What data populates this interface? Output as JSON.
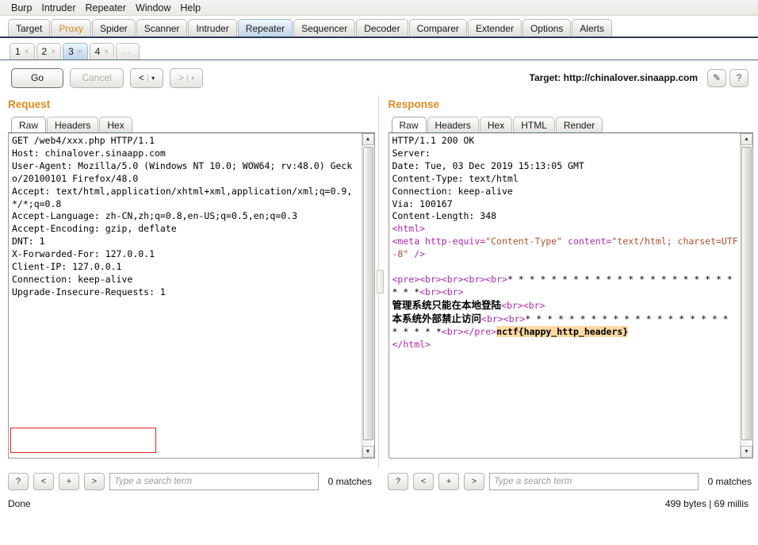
{
  "menu": {
    "items": [
      "Burp",
      "Intruder",
      "Repeater",
      "Window",
      "Help"
    ]
  },
  "main_tabs": [
    {
      "label": "Target",
      "selected": false
    },
    {
      "label": "Proxy",
      "selected": false
    },
    {
      "label": "Spider",
      "selected": false
    },
    {
      "label": "Scanner",
      "selected": false
    },
    {
      "label": "Intruder",
      "selected": false
    },
    {
      "label": "Repeater",
      "selected": true
    },
    {
      "label": "Sequencer",
      "selected": false
    },
    {
      "label": "Decoder",
      "selected": false
    },
    {
      "label": "Comparer",
      "selected": false
    },
    {
      "label": "Extender",
      "selected": false
    },
    {
      "label": "Options",
      "selected": false
    },
    {
      "label": "Alerts",
      "selected": false
    }
  ],
  "repeater_tabs": [
    {
      "label": "1",
      "close": "×",
      "selected": false
    },
    {
      "label": "2",
      "close": "×",
      "selected": false
    },
    {
      "label": "3",
      "close": "×",
      "selected": true
    },
    {
      "label": "4",
      "close": "×",
      "selected": false
    },
    {
      "label": "...",
      "close": "",
      "selected": false
    }
  ],
  "toolbar": {
    "go_label": "Go",
    "cancel_label": "Cancel",
    "back_label": "<",
    "forward_label": ">",
    "caret": "▾",
    "separator": "|",
    "target_label": "Target: http://chinalover.sinaapp.com",
    "edit_icon": "✎",
    "help_icon": "?"
  },
  "request": {
    "title": "Request",
    "tabs": [
      {
        "label": "Raw",
        "selected": true
      },
      {
        "label": "Headers",
        "selected": false
      },
      {
        "label": "Hex",
        "selected": false
      }
    ],
    "body": "GET /web4/xxx.php HTTP/1.1\nHost: chinalover.sinaapp.com\nUser-Agent: Mozilla/5.0 (Windows NT 10.0; WOW64; rv:48.0) Gecko/20100101 Firefox/48.0\nAccept: text/html,application/xhtml+xml,application/xml;q=0.9,*/*;q=0.8\nAccept-Language: zh-CN,zh;q=0.8,en-US;q=0.5,en;q=0.3\nAccept-Encoding: gzip, deflate\nDNT: 1\nX-Forwarded-For: 127.0.0.1\nClient-IP: 127.0.0.1\nConnection: keep-alive\nUpgrade-Insecure-Requests: 1\n",
    "highlighted_headers": [
      "X-Forwarded-For: 127.0.0.1",
      "Client-IP: 127.0.0.1"
    ],
    "highlight_color": "#e02020",
    "search": {
      "help_label": "?",
      "prev_label": "<",
      "add_label": "+",
      "next_label": ">",
      "placeholder": "Type a search term",
      "value": "",
      "matches": "0 matches"
    }
  },
  "response": {
    "title": "Response",
    "tabs": [
      {
        "label": "Raw",
        "selected": true
      },
      {
        "label": "Headers",
        "selected": false
      },
      {
        "label": "Hex",
        "selected": false
      },
      {
        "label": "HTML",
        "selected": false
      },
      {
        "label": "Render",
        "selected": false
      }
    ],
    "headers": "HTTP/1.1 200 OK\nServer:\nDate: Tue, 03 Dec 2019 15:13:05 GMT\nContent-Type: text/html\nConnection: keep-alive\nVia: 100167\nContent-Length: 348\n",
    "body_lines": [
      "<html>",
      "<meta http-equiv=\"Content-Type\" content=\"text/html; charset=UTF-8\" />",
      "",
      "<pre><br><br><br><br>* * * * * * * * * * * * * * * * * * * * * * * *<br><br>",
      "管理系统只能在本地登陆<br><br>",
      "本系统外部禁止访问<br><br>* * * * * * * * * * * * * * * * * * * * * * * *<br></pre>",
      "</html>"
    ],
    "flag": "nctf{happy_http_headers}",
    "flag_highlight_color": "#fcd9a4",
    "tag_color": "#b028b0",
    "attr_color": "#b05030",
    "search": {
      "help_label": "?",
      "prev_label": "<",
      "add_label": "+",
      "next_label": ">",
      "placeholder": "Type a search term",
      "value": "",
      "matches": "0 matches"
    },
    "stats": "499 bytes | 69 millis"
  },
  "status": {
    "left": "Done"
  }
}
